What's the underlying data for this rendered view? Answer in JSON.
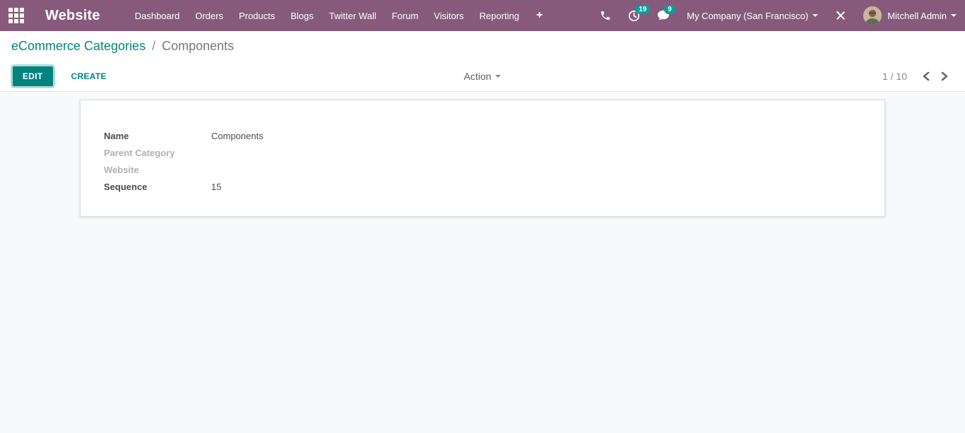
{
  "colors": {
    "navbar_bg": "#875A7B",
    "accent_teal": "#00847D",
    "badge_teal": "#00A09D",
    "muted_label": "#b0b0b0"
  },
  "nav": {
    "app_title": "Website",
    "menu_items": [
      {
        "label": "Dashboard"
      },
      {
        "label": "Orders"
      },
      {
        "label": "Products"
      },
      {
        "label": "Blogs"
      },
      {
        "label": "Twitter Wall"
      },
      {
        "label": "Forum"
      },
      {
        "label": "Visitors"
      },
      {
        "label": "Reporting"
      }
    ],
    "plus_label": "+",
    "activities_count": "19",
    "messages_count": "9",
    "company_label": "My Company (San Francisco)",
    "user_name": "Mitchell Admin",
    "icons": {
      "apps": "apps-grid-icon",
      "phone": "phone-icon",
      "activities": "clock-icon",
      "messages": "chat-bubble-icon",
      "tools": "wrench-screwdriver-icon"
    }
  },
  "breadcrumb": {
    "parent": "eCommerce Categories",
    "separator": "/",
    "current": "Components"
  },
  "control_panel": {
    "edit_label": "EDIT",
    "create_label": "CREATE",
    "action_label": "Action",
    "pager_value": "1 / 10"
  },
  "form": {
    "fields": {
      "name": {
        "label": "Name",
        "value": "Components"
      },
      "parent_category": {
        "label": "Parent Category",
        "value": ""
      },
      "website": {
        "label": "Website",
        "value": ""
      },
      "sequence": {
        "label": "Sequence",
        "value": "15"
      }
    }
  }
}
